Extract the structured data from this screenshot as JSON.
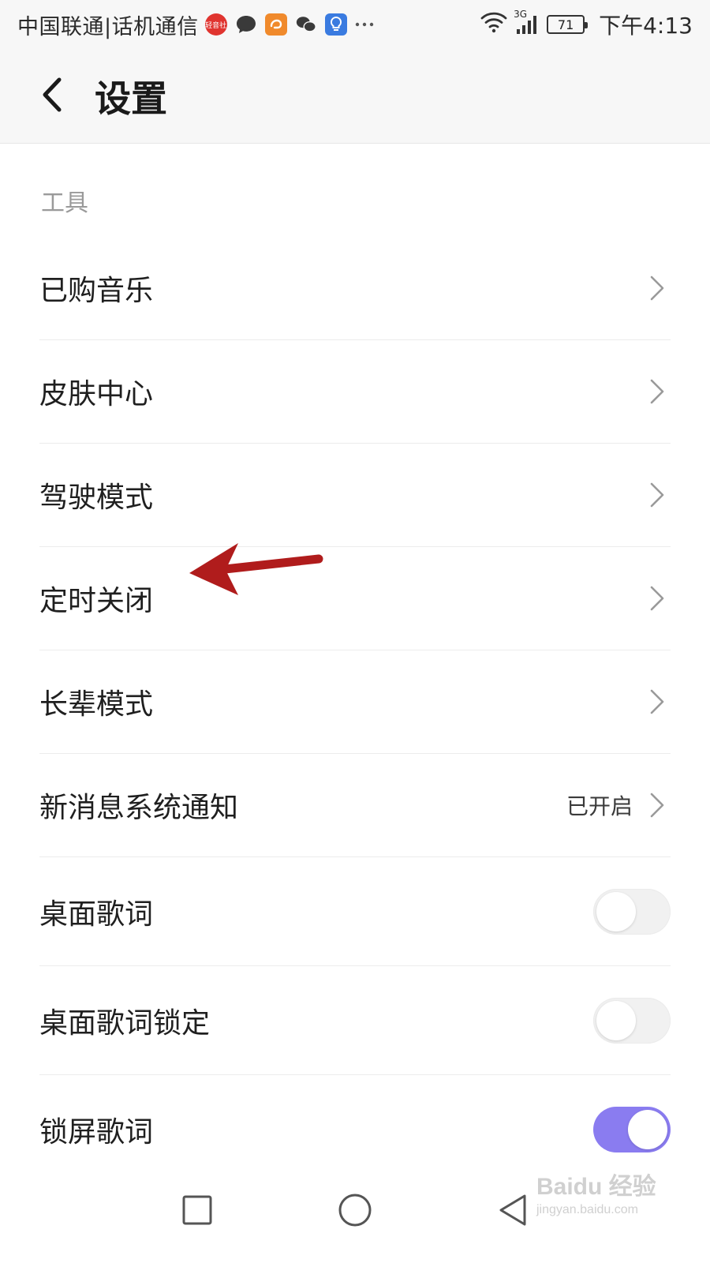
{
  "status_bar": {
    "carrier": "中国联通|话机通信",
    "red_badge_text": "轻音社",
    "network_type": "3G",
    "battery": "71",
    "time": "下午4:13",
    "notification_icons": [
      "qingyinshe-icon",
      "message-bubble-icon",
      "uc-browser-icon",
      "wechat-icon",
      "lightbulb-icon",
      "more-dots-icon"
    ],
    "right_icons": [
      "wifi-icon",
      "signal-icon",
      "battery-icon"
    ]
  },
  "header": {
    "title": "设置",
    "back_icon": "back-arrow-icon"
  },
  "section": {
    "label": "工具"
  },
  "rows": [
    {
      "label": "已购音乐",
      "type": "link"
    },
    {
      "label": "皮肤中心",
      "type": "link"
    },
    {
      "label": "驾驶模式",
      "type": "link"
    },
    {
      "label": "定时关闭",
      "type": "link"
    },
    {
      "label": "长辈模式",
      "type": "link"
    },
    {
      "label": "新消息系统通知",
      "type": "link",
      "value": "已开启"
    },
    {
      "label": "桌面歌词",
      "type": "toggle",
      "on": false
    },
    {
      "label": "桌面歌词锁定",
      "type": "toggle",
      "on": false
    },
    {
      "label": "锁屏歌词",
      "type": "toggle",
      "on": true
    }
  ],
  "nav": {
    "icons": [
      "recent-apps-icon",
      "home-icon",
      "back-icon"
    ]
  },
  "watermark": {
    "main": "Baidu 经验",
    "sub": "jingyan.baidu.com"
  },
  "colors": {
    "accent": "#8a7cf0",
    "annotation_arrow": "#b01c1c",
    "header_bg": "#f7f7f7",
    "secondary_text": "#9a9a9a"
  }
}
